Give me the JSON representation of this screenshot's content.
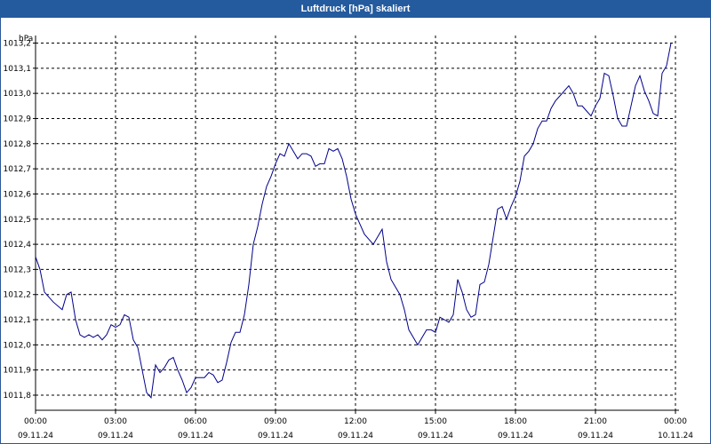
{
  "window": {
    "title": "Luftdruck [hPa] skaliert"
  },
  "chart_data": {
    "type": "line",
    "title": "Luftdruck [hPa] skaliert",
    "ylabel": "hPa",
    "xlabel": "",
    "grid": true,
    "ylim": [
      1011.74,
      1013.23
    ],
    "y_ticks": [
      "1011,8",
      "1011,9",
      "1012,0",
      "1012,1",
      "1012,2",
      "1012,3",
      "1012,4",
      "1012,5",
      "1012,6",
      "1012,7",
      "1012,8",
      "1012,9",
      "1013,0",
      "1013,1",
      "1013,2"
    ],
    "x_ticks": [
      {
        "time": "00:00",
        "date": "09.11.24"
      },
      {
        "time": "03:00",
        "date": "09.11.24"
      },
      {
        "time": "06:00",
        "date": "09.11.24"
      },
      {
        "time": "09:00",
        "date": "09.11.24"
      },
      {
        "time": "12:00",
        "date": "09.11.24"
      },
      {
        "time": "15:00",
        "date": "09.11.24"
      },
      {
        "time": "18:00",
        "date": "09.11.24"
      },
      {
        "time": "21:00",
        "date": "09.11.24"
      },
      {
        "time": "00:00",
        "date": "10.11.24"
      }
    ],
    "series": [
      {
        "color": "#00008b",
        "points": [
          [
            "09.11.24 00:00",
            1012.35
          ],
          [
            "09.11.24 00:10",
            1012.3
          ],
          [
            "09.11.24 00:20",
            1012.21
          ],
          [
            "09.11.24 00:40",
            1012.17
          ],
          [
            "09.11.24 01:00",
            1012.14
          ],
          [
            "09.11.24 01:10",
            1012.2
          ],
          [
            "09.11.24 01:20",
            1012.21
          ],
          [
            "09.11.24 01:30",
            1012.1
          ],
          [
            "09.11.24 01:40",
            1012.04
          ],
          [
            "09.11.24 01:50",
            1012.03
          ],
          [
            "09.11.24 02:00",
            1012.04
          ],
          [
            "09.11.24 02:10",
            1012.03
          ],
          [
            "09.11.24 02:20",
            1012.04
          ],
          [
            "09.11.24 02:30",
            1012.02
          ],
          [
            "09.11.24 02:40",
            1012.04
          ],
          [
            "09.11.24 02:50",
            1012.08
          ],
          [
            "09.11.24 03:00",
            1012.07
          ],
          [
            "09.11.24 03:10",
            1012.08
          ],
          [
            "09.11.24 03:20",
            1012.12
          ],
          [
            "09.11.24 03:30",
            1012.11
          ],
          [
            "09.11.24 03:40",
            1012.02
          ],
          [
            "09.11.24 03:50",
            1011.99
          ],
          [
            "09.11.24 04:00",
            1011.9
          ],
          [
            "09.11.24 04:10",
            1011.81
          ],
          [
            "09.11.24 04:20",
            1011.79
          ],
          [
            "09.11.24 04:30",
            1011.92
          ],
          [
            "09.11.24 04:40",
            1011.89
          ],
          [
            "09.11.24 04:50",
            1011.91
          ],
          [
            "09.11.24 05:00",
            1011.94
          ],
          [
            "09.11.24 05:10",
            1011.95
          ],
          [
            "09.11.24 05:20",
            1011.9
          ],
          [
            "09.11.24 05:30",
            1011.86
          ],
          [
            "09.11.24 05:40",
            1011.81
          ],
          [
            "09.11.24 05:50",
            1011.83
          ],
          [
            "09.11.24 06:00",
            1011.87
          ],
          [
            "09.11.24 06:10",
            1011.87
          ],
          [
            "09.11.24 06:20",
            1011.87
          ],
          [
            "09.11.24 06:30",
            1011.89
          ],
          [
            "09.11.24 06:40",
            1011.88
          ],
          [
            "09.11.24 06:50",
            1011.85
          ],
          [
            "09.11.24 07:00",
            1011.86
          ],
          [
            "09.11.24 07:10",
            1011.93
          ],
          [
            "09.11.24 07:20",
            1012.01
          ],
          [
            "09.11.24 07:30",
            1012.05
          ],
          [
            "09.11.24 07:40",
            1012.05
          ],
          [
            "09.11.24 07:50",
            1012.12
          ],
          [
            "09.11.24 08:00",
            1012.24
          ],
          [
            "09.11.24 08:10",
            1012.4
          ],
          [
            "09.11.24 08:20",
            1012.47
          ],
          [
            "09.11.24 08:30",
            1012.56
          ],
          [
            "09.11.24 08:40",
            1012.63
          ],
          [
            "09.11.24 08:50",
            1012.67
          ],
          [
            "09.11.24 09:00",
            1012.72
          ],
          [
            "09.11.24 09:10",
            1012.76
          ],
          [
            "09.11.24 09:20",
            1012.75
          ],
          [
            "09.11.24 09:30",
            1012.8
          ],
          [
            "09.11.24 09:40",
            1012.77
          ],
          [
            "09.11.24 09:50",
            1012.74
          ],
          [
            "09.11.24 10:00",
            1012.76
          ],
          [
            "09.11.24 10:10",
            1012.76
          ],
          [
            "09.11.24 10:20",
            1012.75
          ],
          [
            "09.11.24 10:30",
            1012.71
          ],
          [
            "09.11.24 10:40",
            1012.72
          ],
          [
            "09.11.24 10:50",
            1012.72
          ],
          [
            "09.11.24 11:00",
            1012.78
          ],
          [
            "09.11.24 11:10",
            1012.77
          ],
          [
            "09.11.24 11:20",
            1012.78
          ],
          [
            "09.11.24 11:30",
            1012.74
          ],
          [
            "09.11.24 11:40",
            1012.67
          ],
          [
            "09.11.24 11:50",
            1012.58
          ],
          [
            "09.11.24 12:00",
            1012.52
          ],
          [
            "09.11.24 12:10",
            1012.48
          ],
          [
            "09.11.24 12:20",
            1012.44
          ],
          [
            "09.11.24 12:30",
            1012.42
          ],
          [
            "09.11.24 12:40",
            1012.4
          ],
          [
            "09.11.24 12:50",
            1012.43
          ],
          [
            "09.11.24 13:00",
            1012.46
          ],
          [
            "09.11.24 13:10",
            1012.33
          ],
          [
            "09.11.24 13:20",
            1012.26
          ],
          [
            "09.11.24 13:30",
            1012.23
          ],
          [
            "09.11.24 13:40",
            1012.2
          ],
          [
            "09.11.24 13:50",
            1012.14
          ],
          [
            "09.11.24 14:00",
            1012.06
          ],
          [
            "09.11.24 14:10",
            1012.03
          ],
          [
            "09.11.24 14:20",
            1012.0
          ],
          [
            "09.11.24 14:30",
            1012.03
          ],
          [
            "09.11.24 14:40",
            1012.06
          ],
          [
            "09.11.24 14:50",
            1012.06
          ],
          [
            "09.11.24 15:00",
            1012.05
          ],
          [
            "09.11.24 15:10",
            1012.11
          ],
          [
            "09.11.24 15:20",
            1012.1
          ],
          [
            "09.11.24 15:30",
            1012.09
          ],
          [
            "09.11.24 15:40",
            1012.12
          ],
          [
            "09.11.24 15:50",
            1012.26
          ],
          [
            "09.11.24 16:00",
            1012.21
          ],
          [
            "09.11.24 16:10",
            1012.14
          ],
          [
            "09.11.24 16:20",
            1012.11
          ],
          [
            "09.11.24 16:30",
            1012.12
          ],
          [
            "09.11.24 16:40",
            1012.24
          ],
          [
            "09.11.24 16:50",
            1012.25
          ],
          [
            "09.11.24 17:00",
            1012.32
          ],
          [
            "09.11.24 17:10",
            1012.43
          ],
          [
            "09.11.24 17:20",
            1012.54
          ],
          [
            "09.11.24 17:30",
            1012.55
          ],
          [
            "09.11.24 17:40",
            1012.5
          ],
          [
            "09.11.24 17:50",
            1012.55
          ],
          [
            "09.11.24 18:00",
            1012.59
          ],
          [
            "09.11.24 18:10",
            1012.65
          ],
          [
            "09.11.24 18:20",
            1012.75
          ],
          [
            "09.11.24 18:30",
            1012.77
          ],
          [
            "09.11.24 18:40",
            1012.8
          ],
          [
            "09.11.24 18:50",
            1012.86
          ],
          [
            "09.11.24 19:00",
            1012.89
          ],
          [
            "09.11.24 19:10",
            1012.89
          ],
          [
            "09.11.24 19:20",
            1012.94
          ],
          [
            "09.11.24 19:30",
            1012.97
          ],
          [
            "09.11.24 19:40",
            1012.99
          ],
          [
            "09.11.24 19:50",
            1013.01
          ],
          [
            "09.11.24 20:00",
            1013.03
          ],
          [
            "09.11.24 20:10",
            1013.0
          ],
          [
            "09.11.24 20:20",
            1012.95
          ],
          [
            "09.11.24 20:30",
            1012.95
          ],
          [
            "09.11.24 20:40",
            1012.93
          ],
          [
            "09.11.24 20:50",
            1012.91
          ],
          [
            "09.11.24 21:00",
            1012.95
          ],
          [
            "09.11.24 21:10",
            1012.98
          ],
          [
            "09.11.24 21:20",
            1013.08
          ],
          [
            "09.11.24 21:30",
            1013.07
          ],
          [
            "09.11.24 21:40",
            1012.99
          ],
          [
            "09.11.24 21:50",
            1012.9
          ],
          [
            "09.11.24 22:00",
            1012.87
          ],
          [
            "09.11.24 22:10",
            1012.87
          ],
          [
            "09.11.24 22:20",
            1012.95
          ],
          [
            "09.11.24 22:30",
            1013.03
          ],
          [
            "09.11.24 22:40",
            1013.07
          ],
          [
            "09.11.24 22:50",
            1013.01
          ],
          [
            "09.11.24 23:00",
            1012.97
          ],
          [
            "09.11.24 23:10",
            1012.92
          ],
          [
            "09.11.24 23:20",
            1012.91
          ],
          [
            "09.11.24 23:30",
            1013.08
          ],
          [
            "09.11.24 23:40",
            1013.11
          ],
          [
            "09.11.24 23:50",
            1013.2
          ]
        ]
      }
    ]
  }
}
